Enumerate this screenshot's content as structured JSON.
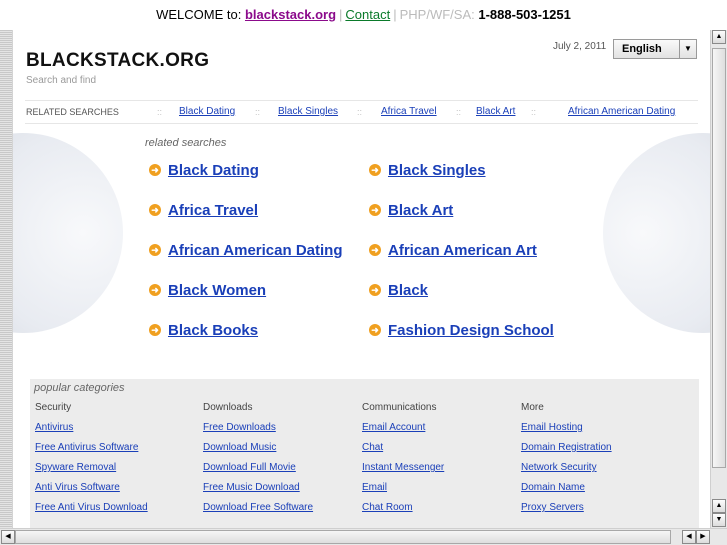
{
  "topbar": {
    "welcome": "WELCOME to: ",
    "site": "blackstack.org",
    "separator": "|",
    "contact": "Contact",
    "ppc": "PHP/WF/SA:",
    "phone": "1-888-503-1251"
  },
  "header": {
    "title": "BLACKSTACK.ORG",
    "subtitle": "Search and find",
    "date": "July 2, 2011",
    "language": "English"
  },
  "related_bar": {
    "label": "RELATED SEARCHES",
    "separator": "::",
    "links": [
      "Black Dating",
      "Black Singles",
      "Africa Travel",
      "Black Art",
      "African American Dating"
    ]
  },
  "related": {
    "heading": "related searches",
    "bullet_glyph": "➜",
    "links": [
      "Black Dating",
      "Black Singles",
      "Africa Travel",
      "Black Art",
      "African American Dating",
      "African American Art",
      "Black Women",
      "Black",
      "Black Books",
      "Fashion Design School"
    ]
  },
  "popular": {
    "heading": "popular categories",
    "columns": [
      {
        "title": "Security",
        "links": [
          "Antivirus",
          "Free Antivirus Software",
          "Spyware Removal",
          "Anti Virus Software",
          "Free Anti Virus Download"
        ]
      },
      {
        "title": "Downloads",
        "links": [
          "Free Downloads",
          "Download Music",
          "Download Full Movie",
          "Free Music Download",
          "Download Free Software"
        ]
      },
      {
        "title": "Communications",
        "links": [
          "Email Account",
          "Chat",
          "Instant Messenger",
          "Email",
          "Chat Room"
        ]
      },
      {
        "title": "More",
        "links": [
          "Email Hosting",
          "Domain Registration",
          "Network Security",
          "Domain Name",
          "Proxy Servers"
        ]
      }
    ]
  },
  "colors": {
    "link": "#1a3fb8",
    "site_name": "#8b0a8b",
    "contact": "#0a7a2a",
    "bullet": "#f0a020"
  },
  "icons": {
    "dropdown": "chevron-down-icon",
    "bullet": "arrow-right-circle-icon",
    "scroll_up": "arrow-up-icon",
    "scroll_down": "arrow-down-icon",
    "scroll_left": "arrow-left-icon",
    "scroll_right": "arrow-right-icon"
  }
}
